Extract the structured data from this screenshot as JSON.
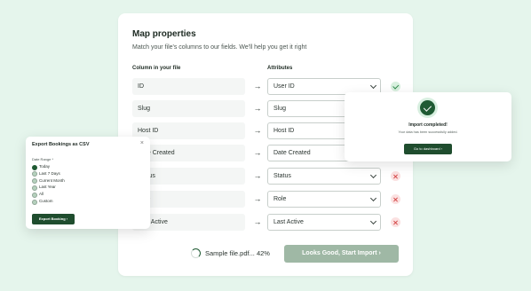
{
  "main": {
    "title": "Map properties",
    "subtitle": "Match your file's columns to our fields. We'll help you get it right",
    "col_header": "Column in your file",
    "attr_header": "Attributes",
    "arrow": "→",
    "rows": [
      {
        "column": "ID",
        "attribute": "User ID",
        "status": "ok"
      },
      {
        "column": "Slug",
        "attribute": "Slug",
        "status": "ok"
      },
      {
        "column": "Host ID",
        "attribute": "Host ID",
        "status": "ok"
      },
      {
        "column": "Date Created",
        "attribute": "Date Created",
        "status": "ok"
      },
      {
        "column": "Status",
        "attribute": "Status",
        "status": "error"
      },
      {
        "column": "Role",
        "attribute": "Role",
        "status": "error"
      },
      {
        "column": "Last Active",
        "attribute": "Last Active",
        "status": "error"
      }
    ],
    "upload_text": "Sample file.pdf... 42%",
    "import_button": "Looks Good, Start Import  ›"
  },
  "export": {
    "title": "Export Bookings as CSV",
    "close": "×",
    "date_range_label": "Date Range *",
    "options": [
      "Today",
      "Last 7 Days",
      "Current Month",
      "Last Year",
      "All",
      "Custom"
    ],
    "selected": 0,
    "button": "Export Booking  ›"
  },
  "complete": {
    "title": "Import completed!",
    "subtitle": "Your data has been successfully added.",
    "button": "Go to dashboard  ›"
  },
  "colors": {
    "background": "#e5f5ec",
    "brand_dark": "#1f4d2e",
    "import_disabled": "#9fb8a5",
    "ok": "#2f8a4a",
    "error": "#d44848"
  }
}
